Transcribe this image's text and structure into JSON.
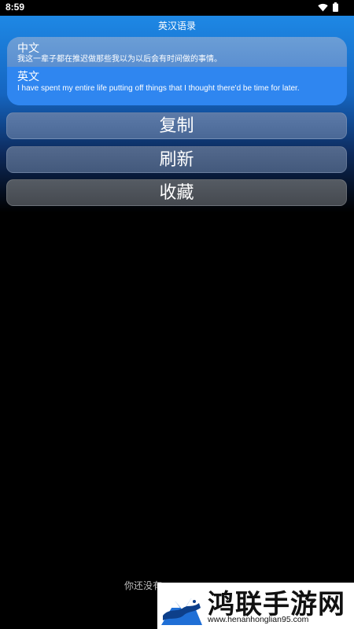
{
  "status_bar": {
    "time": "8:59",
    "icons": [
      "wifi-icon",
      "battery-icon"
    ]
  },
  "app": {
    "title": "英汉语录"
  },
  "quote": {
    "cn_label": "中文",
    "cn_text": "我这一辈子都在推迟做那些我以为以后会有时间做的事情。",
    "en_label": "英文",
    "en_text": "I have spent my entire life putting off things that I thought there'd be time for later."
  },
  "actions": {
    "copy": "复制",
    "refresh": "刷新",
    "favorite": "收藏"
  },
  "footer": {
    "hint": "你还没有"
  },
  "watermark": {
    "title": "鸿联手游网",
    "url": "www.henanhonglian95.com"
  },
  "colors": {
    "accent_blue": "#2f86f0",
    "background": "#000000"
  }
}
